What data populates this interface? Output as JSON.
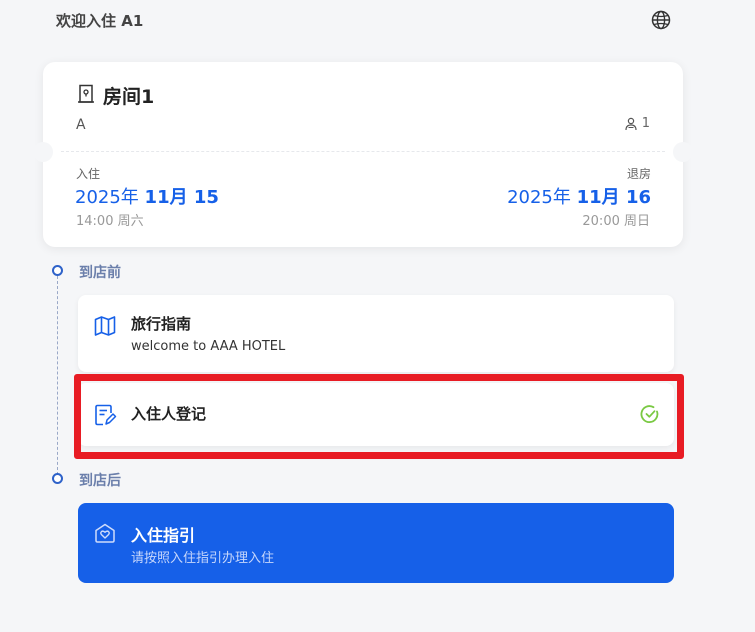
{
  "header": {
    "welcome": "欢迎入住 A1",
    "language_icon": "globe-icon"
  },
  "room": {
    "title": "房间1",
    "subtitle": "A",
    "guest_count": "1",
    "checkin": {
      "label": "入住",
      "year": "2025年",
      "month_day": "11月 15",
      "time_weekday": "14:00 周六"
    },
    "checkout": {
      "label": "退房",
      "year": "2025年",
      "month_day": "11月 16",
      "time_weekday": "20:00 周日"
    }
  },
  "timeline": {
    "before": {
      "label": "到店前",
      "items": [
        {
          "title": "旅行指南",
          "description": "welcome to AAA HOTEL",
          "icon": "map-icon"
        },
        {
          "title": "入住人登记",
          "icon": "registration-form-icon",
          "status_icon": "check-circle-icon",
          "completed": true
        }
      ]
    },
    "after": {
      "label": "到店后",
      "items": [
        {
          "title": "入住指引",
          "description": "请按照入住指引办理入住",
          "icon": "house-heart-icon"
        }
      ]
    }
  },
  "colors": {
    "accent": "#1660e8",
    "highlight_border": "#e81c24",
    "success": "#7ac943",
    "section_label": "#6b7fab"
  }
}
